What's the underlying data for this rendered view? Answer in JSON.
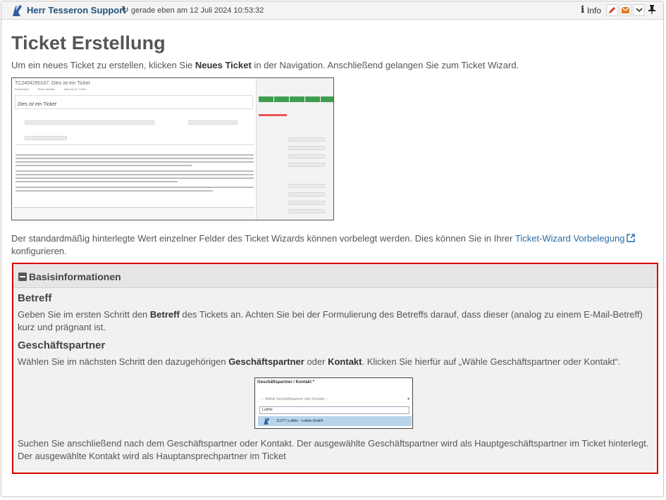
{
  "header": {
    "author": "Herr Tesseron Support",
    "timestamp": "gerade eben am 12 Juli 2024 10:53:32",
    "info_label": "Info",
    "icons": [
      "refresh-icon",
      "info-icon",
      "edit-icon",
      "mail-icon",
      "chevron-down-icon",
      "pin-icon"
    ],
    "colors": {
      "edit": "#d9342b",
      "mail": "#e07b1f",
      "author": "#23527c"
    }
  },
  "article": {
    "title": "Ticket Erstellung",
    "intro": {
      "pre": "Um ein neues Ticket zu erstellen, klicken Sie ",
      "bold": "Neues Ticket",
      "post": " in der Navigation. Anschließend gelangen Sie zum Ticket Wizard."
    },
    "screenshot": {
      "ticket_title": "TC2404290107: Dies ist ein Ticket",
      "tabs": [
        "Dashboard",
        "Ticket-Verlauf",
        "Dies ist ein Ticket"
      ],
      "subject": "Dies ist ein Ticket"
    },
    "defaults_text": {
      "pre": "Der standardmäßig hinterlegte Wert einzelner Felder des Ticket Wizards können vorbelegt werden. Dies können Sie in Ihrer ",
      "link": "Ticket-Wizard Vorbelegung",
      "post": "konfigurieren."
    }
  },
  "basis": {
    "section_title": "Basisinformationen",
    "betreff_heading": "Betreff",
    "betreff_text": {
      "pre": "Geben Sie im ersten Schritt den ",
      "bold": "Betreff",
      "post1": " des Tickets an. Achten Sie bei der Formulierung des Betreffs darauf, dass dieser (analog zu einem E-Mail-Betreff)",
      "post2": "kurz und prägnant ist."
    },
    "partner_heading": "Geschäftspartner",
    "partner_text": {
      "pre": "Wählen Sie im nächsten Schritt den dazugehörigen ",
      "bold1": "Geschäftspartner",
      "mid": " oder ",
      "bold2": "Kontakt",
      "post": ". Klicken Sie hierfür auf „Wähle Geschäftspartner oder Kontakt“."
    },
    "dropdown": {
      "label": "Geschäftspartner / Kontakt *",
      "placeholder": "--- Wähle Geschäftspartner oder Kontakt ---",
      "search": "Luithle",
      "option": "11277: Luithle - Luithle GmbH"
    },
    "search_text_1": "Suchen Sie anschließend nach dem Geschäftspartner oder Kontakt. Der ausgewählte Geschäftspartner wird als Hauptgeschäftspartner im Ticket hinterlegt.",
    "search_text_2": "Der ausgewählte Kontakt wird als Hauptansprechpartner im Ticket",
    "highlight_color": "#d80000"
  }
}
